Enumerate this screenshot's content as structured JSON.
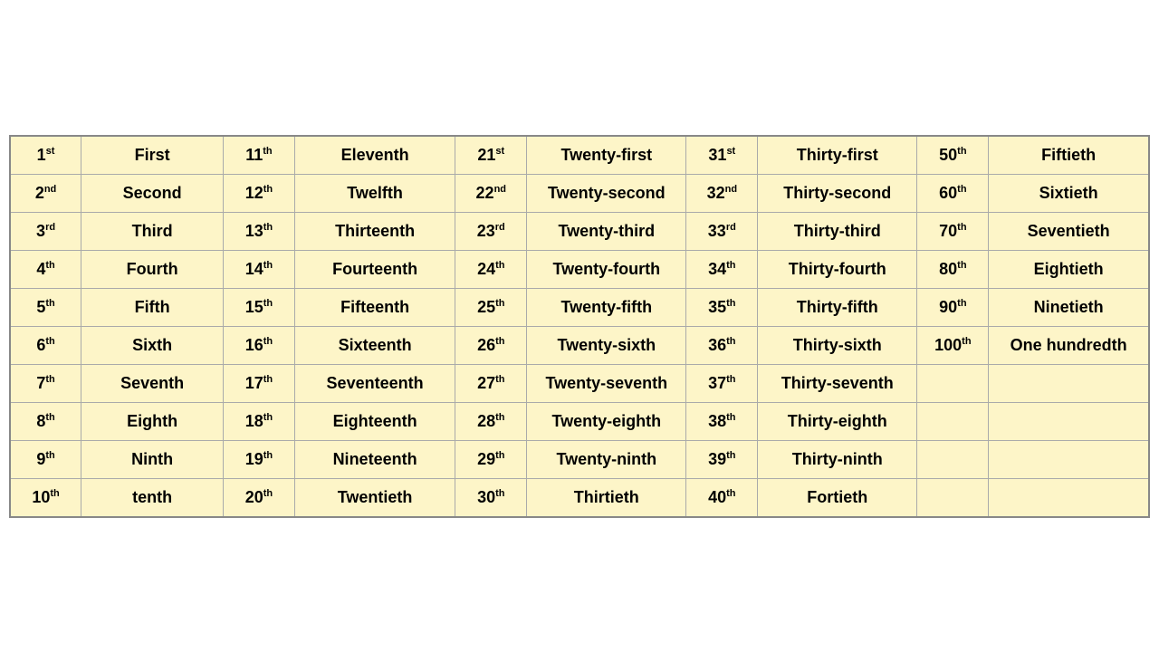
{
  "rows": [
    {
      "c1_num": "1",
      "c1_sup": "st",
      "c1_word": "First",
      "c2_num": "11",
      "c2_sup": "th",
      "c2_word": "Eleventh",
      "c3_num": "21",
      "c3_sup": "st",
      "c3_word": "Twenty-first",
      "c4_num": "31",
      "c4_sup": "st",
      "c4_word": "Thirty-first",
      "c5_num": "50",
      "c5_sup": "th",
      "c5_word": "Fiftieth"
    },
    {
      "c1_num": "2",
      "c1_sup": "nd",
      "c1_word": "Second",
      "c2_num": "12",
      "c2_sup": "th",
      "c2_word": "Twelfth",
      "c3_num": "22",
      "c3_sup": "nd",
      "c3_word": "Twenty-second",
      "c4_num": "32",
      "c4_sup": "nd",
      "c4_word": "Thirty-second",
      "c5_num": "60",
      "c5_sup": "th",
      "c5_word": "Sixtieth"
    },
    {
      "c1_num": "3",
      "c1_sup": "rd",
      "c1_word": "Third",
      "c2_num": "13",
      "c2_sup": "th",
      "c2_word": "Thirteenth",
      "c3_num": "23",
      "c3_sup": "rd",
      "c3_word": "Twenty-third",
      "c4_num": "33",
      "c4_sup": "rd",
      "c4_word": "Thirty-third",
      "c5_num": "70",
      "c5_sup": "th",
      "c5_word": "Seventieth"
    },
    {
      "c1_num": "4",
      "c1_sup": "th",
      "c1_word": "Fourth",
      "c2_num": "14",
      "c2_sup": "th",
      "c2_word": "Fourteenth",
      "c3_num": "24",
      "c3_sup": "th",
      "c3_word": "Twenty-fourth",
      "c4_num": "34",
      "c4_sup": "th",
      "c4_word": "Thirty-fourth",
      "c5_num": "80",
      "c5_sup": "th",
      "c5_word": "Eightieth"
    },
    {
      "c1_num": "5",
      "c1_sup": "th",
      "c1_word": "Fifth",
      "c2_num": "15",
      "c2_sup": "th",
      "c2_word": "Fifteenth",
      "c3_num": "25",
      "c3_sup": "th",
      "c3_word": "Twenty-fifth",
      "c4_num": "35",
      "c4_sup": "th",
      "c4_word": "Thirty-fifth",
      "c5_num": "90",
      "c5_sup": "th",
      "c5_word": "Ninetieth"
    },
    {
      "c1_num": "6",
      "c1_sup": "th",
      "c1_word": "Sixth",
      "c2_num": "16",
      "c2_sup": "th",
      "c2_word": "Sixteenth",
      "c3_num": "26",
      "c3_sup": "th",
      "c3_word": "Twenty-sixth",
      "c4_num": "36",
      "c4_sup": "th",
      "c4_word": "Thirty-sixth",
      "c5_num": "100",
      "c5_sup": "th",
      "c5_word": "One hundredth"
    },
    {
      "c1_num": "7",
      "c1_sup": "th",
      "c1_word": "Seventh",
      "c2_num": "17",
      "c2_sup": "th",
      "c2_word": "Seventeenth",
      "c3_num": "27",
      "c3_sup": "th",
      "c3_word": "Twenty-seventh",
      "c4_num": "37",
      "c4_sup": "th",
      "c4_word": "Thirty-seventh",
      "c5_num": "",
      "c5_sup": "",
      "c5_word": ""
    },
    {
      "c1_num": "8",
      "c1_sup": "th",
      "c1_word": "Eighth",
      "c2_num": "18",
      "c2_sup": "th",
      "c2_word": "Eighteenth",
      "c3_num": "28",
      "c3_sup": "th",
      "c3_word": "Twenty-eighth",
      "c4_num": "38",
      "c4_sup": "th",
      "c4_word": "Thirty-eighth",
      "c5_num": "",
      "c5_sup": "",
      "c5_word": ""
    },
    {
      "c1_num": "9",
      "c1_sup": "th",
      "c1_word": "Ninth",
      "c2_num": "19",
      "c2_sup": "th",
      "c2_word": "Nineteenth",
      "c3_num": "29",
      "c3_sup": "th",
      "c3_word": "Twenty-ninth",
      "c4_num": "39",
      "c4_sup": "th",
      "c4_word": "Thirty-ninth",
      "c5_num": "",
      "c5_sup": "",
      "c5_word": ""
    },
    {
      "c1_num": "10",
      "c1_sup": "th",
      "c1_word": "tenth",
      "c2_num": "20",
      "c2_sup": "th",
      "c2_word": "Twentieth",
      "c3_num": "30",
      "c3_sup": "th",
      "c3_word": "Thirtieth",
      "c4_num": "40",
      "c4_sup": "th",
      "c4_word": "Fortieth",
      "c5_num": "",
      "c5_sup": "",
      "c5_word": ""
    }
  ]
}
